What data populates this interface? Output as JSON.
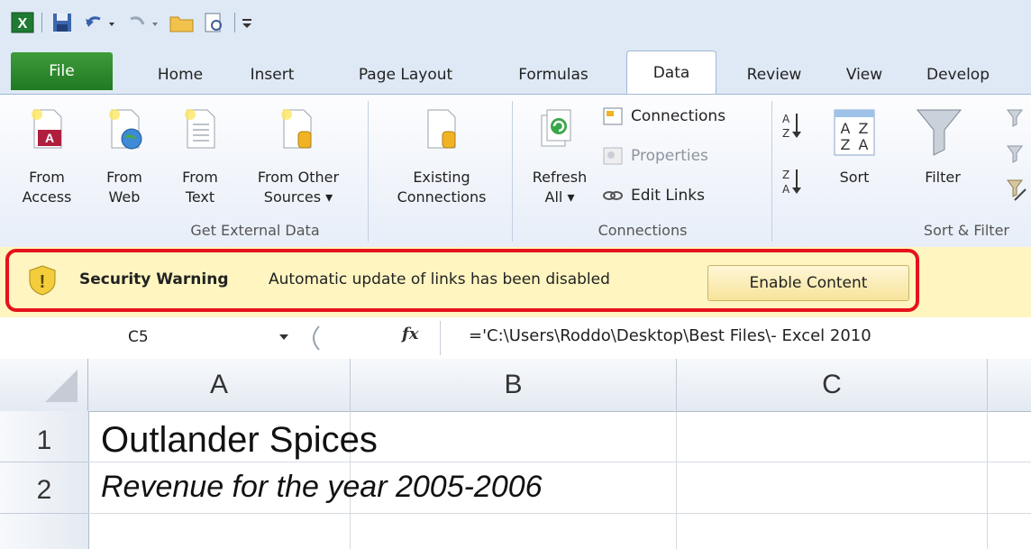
{
  "tabs": [
    "File",
    "Home",
    "Insert",
    "Page Layout",
    "Formulas",
    "Data",
    "Review",
    "View",
    "Develop"
  ],
  "ribbon": {
    "get_external_data": {
      "label": "Get External Data",
      "buttons": [
        {
          "line1": "From",
          "line2": "Access"
        },
        {
          "line1": "From",
          "line2": "Web"
        },
        {
          "line1": "From",
          "line2": "Text"
        },
        {
          "line1": "From Other",
          "line2": "Sources ▾"
        },
        {
          "line1": "Existing",
          "line2": "Connections"
        }
      ]
    },
    "connections": {
      "label": "Connections",
      "refresh": {
        "line1": "Refresh",
        "line2": "All ▾"
      },
      "connections_btn": "Connections",
      "properties_btn": "Properties",
      "edit_links_btn": "Edit Links"
    },
    "sort_filter": {
      "label": "Sort & Filter",
      "sort": "Sort",
      "filter": "Filter"
    }
  },
  "security_bar": {
    "title": "Security Warning",
    "message": "Automatic update of links has been disabled",
    "button": "Enable Content"
  },
  "formula_bar": {
    "name_box": "C5",
    "fx": "fx",
    "formula": "='C:\\Users\\Roddo\\Desktop\\Best Files\\- Excel 2010"
  },
  "grid": {
    "columns": [
      "A",
      "B",
      "C"
    ],
    "rows": [
      {
        "num": "1",
        "a": "Outlander Spices"
      },
      {
        "num": "2",
        "a": "Revenue for the year 2005-2006"
      }
    ]
  },
  "colors": {
    "accent_red": "#e5131b",
    "file_tab": "#2e8b32",
    "warning_bg": "#fef5c1"
  }
}
